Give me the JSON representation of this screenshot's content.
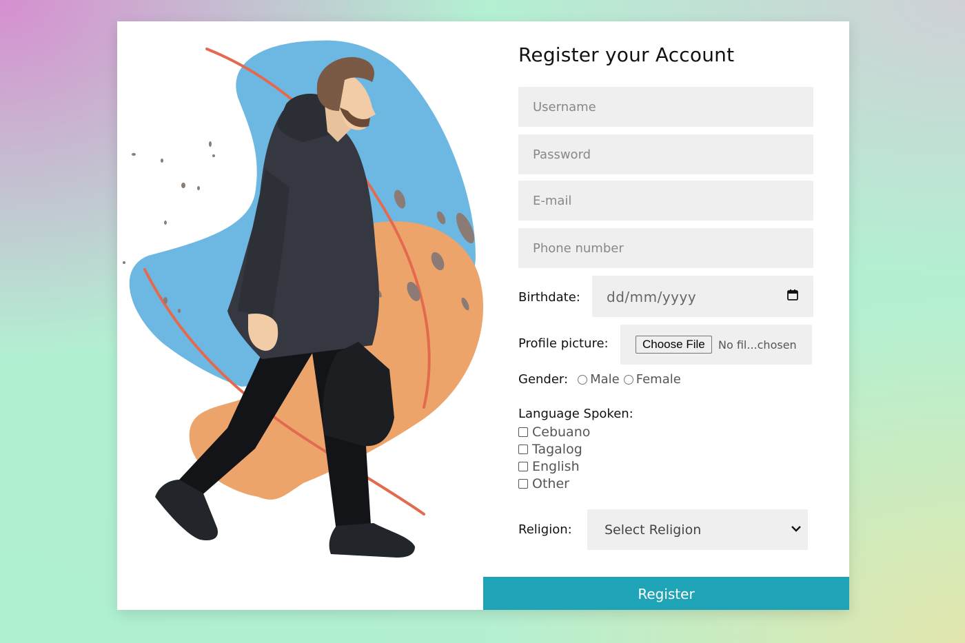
{
  "form": {
    "title": "Register your Account",
    "username_placeholder": "Username",
    "password_placeholder": "Password",
    "email_placeholder": "E-mail",
    "phone_placeholder": "Phone number",
    "birthdate_label": "Birthdate:",
    "birthdate_placeholder": "dd/mm/yyyy",
    "profile_label": "Profile picture:",
    "choose_file_label": "Choose File",
    "file_status": "No fil...chosen",
    "gender_label": "Gender:",
    "gender_options": [
      "Male",
      "Female"
    ],
    "language_label": "Language Spoken:",
    "languages": [
      "Cebuano",
      "Tagalog",
      "English",
      "Other"
    ],
    "religion_label": "Religion:",
    "religion_selected": "Select Religion",
    "submit_label": "Register"
  },
  "icons": {
    "calendar": "calendar-icon",
    "dropdown": "chevron-down-icon"
  },
  "colors": {
    "accent": "#1ea4b6",
    "field_bg": "#efefef",
    "illustration_blue": "#6db8e2",
    "illustration_orange": "#eda46b",
    "illustration_line": "#e36a4e"
  }
}
